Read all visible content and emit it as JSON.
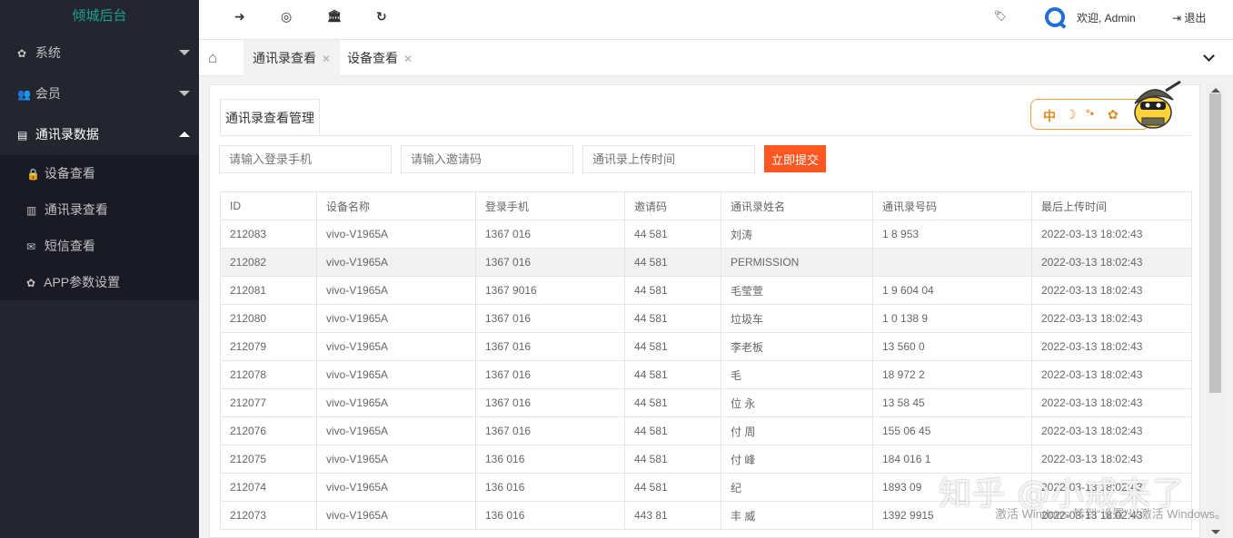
{
  "sidebar": {
    "logo": "倾城后台",
    "menus": [
      {
        "icon": "gear-icon",
        "glyph": "✿",
        "label": "系统"
      },
      {
        "icon": "users-icon",
        "glyph": "👥",
        "label": "会员"
      },
      {
        "icon": "id-card-icon",
        "glyph": "▤",
        "label": "通讯录数据"
      }
    ],
    "sub_items": [
      {
        "icon": "lock-icon",
        "glyph": "🔒",
        "label": "设备查看"
      },
      {
        "icon": "building-icon",
        "glyph": "▥",
        "label": "通讯录查看"
      },
      {
        "icon": "envelope-icon",
        "glyph": "✉",
        "label": "短信查看"
      },
      {
        "icon": "gear-icon",
        "glyph": "✿",
        "label": "APP参数设置"
      }
    ]
  },
  "header": {
    "icons": [
      {
        "name": "arrow-right-icon",
        "glyph": "➜"
      },
      {
        "name": "lifebuoy-icon",
        "glyph": "◎"
      },
      {
        "name": "bank-icon",
        "glyph": "🏛"
      },
      {
        "name": "refresh-icon",
        "glyph": "↻"
      }
    ],
    "tag_glyph": "🏷",
    "welcome": "欢迎, Admin",
    "logout": "退出",
    "logout_glyph": "⇥"
  },
  "tabs": {
    "home_glyph": "⌂",
    "items": [
      {
        "label": "通讯录查看",
        "close": "✕"
      },
      {
        "label": "设备查看",
        "close": "✕"
      }
    ]
  },
  "panel": {
    "title": "通讯录查看管理",
    "widget": {
      "zh": "中",
      "moon": "☽",
      "dots": "°•",
      "gear": "✿"
    },
    "search": {
      "phone_placeholder": "请输入登录手机",
      "invite_placeholder": "请输入邀请码",
      "time_placeholder": "通讯录上传时间",
      "submit": "立即提交"
    }
  },
  "table": {
    "columns": [
      "ID",
      "设备名称",
      "登录手机",
      "邀请码",
      "通讯录姓名",
      "通讯录号码",
      "最后上传时间"
    ],
    "rows": [
      [
        "212083",
        "vivo-V1965A",
        "1367   016",
        "44 581",
        "刘涛",
        "1 8  953",
        "2022-03-13 18:02:43"
      ],
      [
        "212082",
        "vivo-V1965A",
        "1367   016",
        "44 581",
        "PERMISSION",
        "",
        "2022-03-13 18:02:43"
      ],
      [
        "212081",
        "vivo-V1965A",
        "1367  9016",
        "44 581",
        "毛莹萱",
        "1 9 604 04",
        "2022-03-13 18:02:43"
      ],
      [
        "212080",
        "vivo-V1965A",
        "1367   016",
        "44 581",
        "垃圾车",
        "1 0 138 9",
        "2022-03-13 18:02:43"
      ],
      [
        "212079",
        "vivo-V1965A",
        "1367   016",
        "44 581",
        "李老板",
        "13  560 0",
        "2022-03-13 18:02:43"
      ],
      [
        "212078",
        "vivo-V1965A",
        "1367   016",
        "44 581",
        "毛",
        "18  972 2",
        "2022-03-13 18:02:43"
      ],
      [
        "212077",
        "vivo-V1965A",
        "1367   016",
        "44 581",
        "位  永",
        "13   58 45",
        "2022-03-13 18:02:43"
      ],
      [
        "212076",
        "vivo-V1965A",
        "1367   016",
        "44 581",
        "付  周",
        "155 06 45",
        "2022-03-13 18:02:43"
      ],
      [
        "212075",
        "vivo-V1965A",
        "136    016",
        "44 581",
        "付  峰",
        "184  016 1",
        "2022-03-13 18:02:43"
      ],
      [
        "212074",
        "vivo-V1965A",
        "136    016",
        "44 581",
        "纪",
        "1893  09  ",
        "2022-03-13 18:02:43"
      ],
      [
        "212073",
        "vivo-V1965A",
        "136    016",
        "443 81",
        "丰  威",
        "1392   9915",
        "2022-03-13 18:02:43"
      ]
    ],
    "highlight_row": 1
  },
  "watermark": {
    "text": "知乎 @小戒来了",
    "windows": "激活 Windows  转到“设置”以激活 Windows。"
  },
  "colors": {
    "sidebar_bg": "#23262e",
    "logo": "#1aa094",
    "submit": "#ff5722",
    "widget_border": "#e3a23a"
  }
}
